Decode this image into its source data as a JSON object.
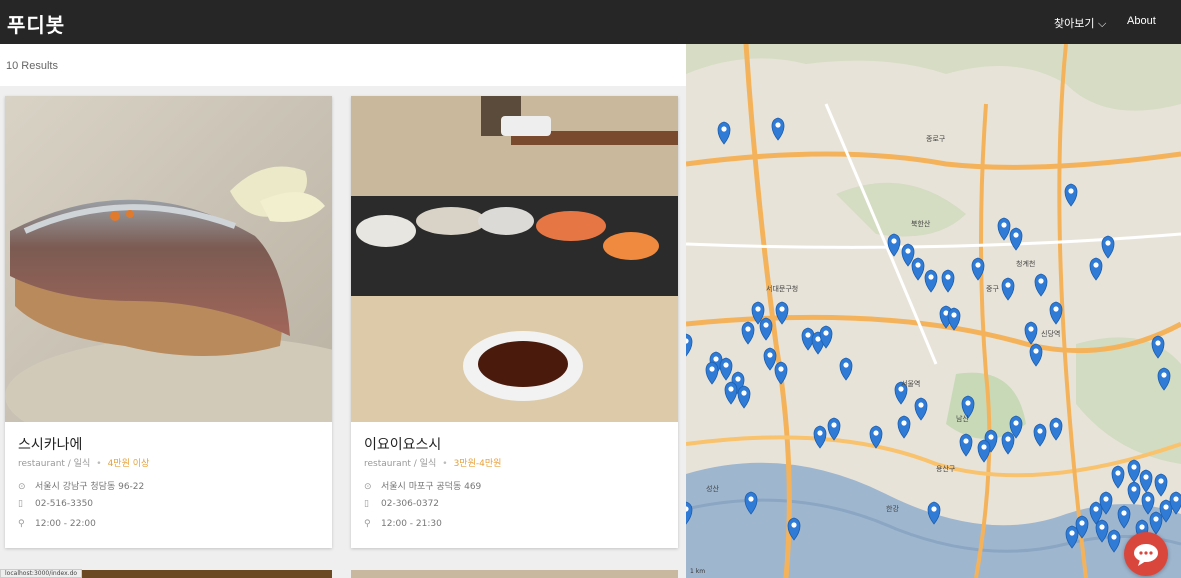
{
  "header": {
    "brand": "푸디봇",
    "nav_explore": "찾아보기 ⌵",
    "nav_about": "About"
  },
  "results": {
    "count_text": "10 Results"
  },
  "cards": [
    {
      "name": "스시카나에",
      "type": "restaurant / 일식",
      "price": "4만원 이상",
      "address": "서울시 강남구 청담동 96-22",
      "phone": "02-516-3350",
      "hours": "12:00 - 22:00"
    },
    {
      "name": "이요이요스시",
      "type": "restaurant / 일식",
      "price": "3만원-4만원",
      "address": "서울시 마포구 공덕동 469",
      "phone": "02-306-0372",
      "hours": "12:00 - 21:30"
    }
  ],
  "map": {
    "labels": [
      "서대문구청",
      "서울역",
      "신당역",
      "북한산",
      "종로구",
      "한강",
      "성산",
      "중구",
      "용산구",
      "청계천",
      "남산"
    ],
    "scale_text": "1 km",
    "marker_color": "#2f7bd6"
  },
  "status_url": "localhost:3000/index.do",
  "colors": {
    "accent_price": "#e6a13b",
    "chat": "#d9463c",
    "topbar": "#262626"
  }
}
